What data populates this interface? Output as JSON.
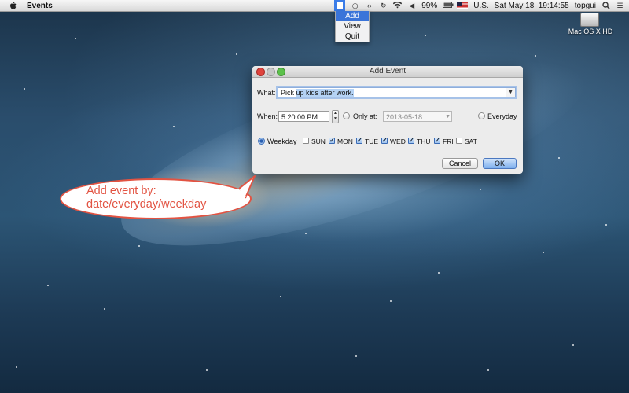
{
  "menubar": {
    "app_name": "Events",
    "percent": "99%",
    "input_source": "U.S.",
    "datetime": "Sat May 18  19:14:55",
    "user": "topgui"
  },
  "events_menu": {
    "items": [
      "Add",
      "View",
      "Quit"
    ],
    "selected": "Add"
  },
  "desktop": {
    "drive_label": "Mac OS X HD"
  },
  "dialog": {
    "title": "Add Event",
    "what_label": "What:",
    "what_value_prefix": "Pick ",
    "what_value_selected": "up kids after work.",
    "when_label": "When:",
    "time_value": "5:20:00 PM",
    "only_at_label": "Only at:",
    "date_value": "2013-05-18",
    "everyday_label": "Everyday",
    "weekday_label": "Weekday",
    "selected_mode": "Weekday",
    "days": [
      {
        "label": "SUN",
        "checked": false
      },
      {
        "label": "MON",
        "checked": true
      },
      {
        "label": "TUE",
        "checked": true
      },
      {
        "label": "WED",
        "checked": true
      },
      {
        "label": "THU",
        "checked": true
      },
      {
        "label": "FRI",
        "checked": true
      },
      {
        "label": "SAT",
        "checked": false
      }
    ],
    "cancel_label": "Cancel",
    "ok_label": "OK"
  },
  "callout": {
    "line1": "Add event by:",
    "line2": "date/everyday/weekday"
  },
  "colors": {
    "accent": "#3a74d9",
    "callout": "#e25342"
  }
}
